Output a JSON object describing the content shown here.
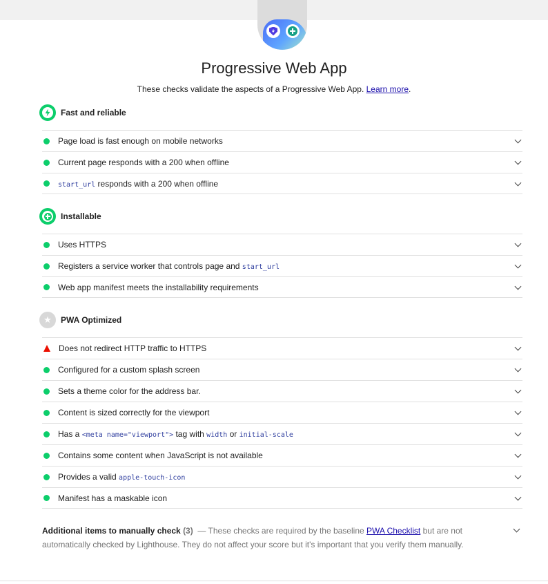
{
  "header": {
    "title": "Progressive Web App",
    "description": "These checks validate the aspects of a Progressive Web App.",
    "learn_more": "Learn more",
    "period": "."
  },
  "groups": [
    {
      "title": "Fast and reliable",
      "icon": "lightning-icon",
      "audits": [
        {
          "status": "pass",
          "parts": [
            {
              "t": "Page load is fast enough on mobile networks"
            }
          ]
        },
        {
          "status": "pass",
          "parts": [
            {
              "t": "Current page responds with a 200 when offline"
            }
          ]
        },
        {
          "status": "pass",
          "parts": [
            {
              "c": "start_url"
            },
            {
              "t": " responds with a 200 when offline"
            }
          ]
        }
      ]
    },
    {
      "title": "Installable",
      "icon": "plus-icon",
      "audits": [
        {
          "status": "pass",
          "parts": [
            {
              "t": "Uses HTTPS"
            }
          ]
        },
        {
          "status": "pass",
          "parts": [
            {
              "t": "Registers a service worker that controls page and "
            },
            {
              "c": "start_url"
            }
          ]
        },
        {
          "status": "pass",
          "parts": [
            {
              "t": "Web app manifest meets the installability requirements"
            }
          ]
        }
      ]
    },
    {
      "title": "PWA Optimized",
      "icon": "star-icon",
      "audits": [
        {
          "status": "fail",
          "parts": [
            {
              "t": "Does not redirect HTTP traffic to HTTPS"
            }
          ]
        },
        {
          "status": "pass",
          "parts": [
            {
              "t": "Configured for a custom splash screen"
            }
          ]
        },
        {
          "status": "pass",
          "parts": [
            {
              "t": "Sets a theme color for the address bar."
            }
          ]
        },
        {
          "status": "pass",
          "parts": [
            {
              "t": "Content is sized correctly for the viewport"
            }
          ]
        },
        {
          "status": "pass",
          "parts": [
            {
              "t": "Has a "
            },
            {
              "c": "<meta name=\"viewport\">"
            },
            {
              "t": " tag with "
            },
            {
              "c": "width"
            },
            {
              "t": " or "
            },
            {
              "c": "initial-scale"
            }
          ]
        },
        {
          "status": "pass",
          "parts": [
            {
              "t": "Contains some content when JavaScript is not available"
            }
          ]
        },
        {
          "status": "pass",
          "parts": [
            {
              "t": "Provides a valid "
            },
            {
              "c": "apple-touch-icon"
            }
          ]
        },
        {
          "status": "pass",
          "parts": [
            {
              "t": "Manifest has a maskable icon"
            }
          ]
        }
      ]
    }
  ],
  "manual": {
    "title": "Additional items to manually check",
    "count": "(3)",
    "dash": "—",
    "text_before": "These checks are required by the baseline",
    "link": "PWA Checklist",
    "text_after": "but are not automatically checked by Lighthouse. They do not affect your score but it's important that you verify them manually."
  },
  "colors": {
    "pass": "#0cce6b",
    "fail": "#eb0f00",
    "link": "#1a0dab"
  }
}
